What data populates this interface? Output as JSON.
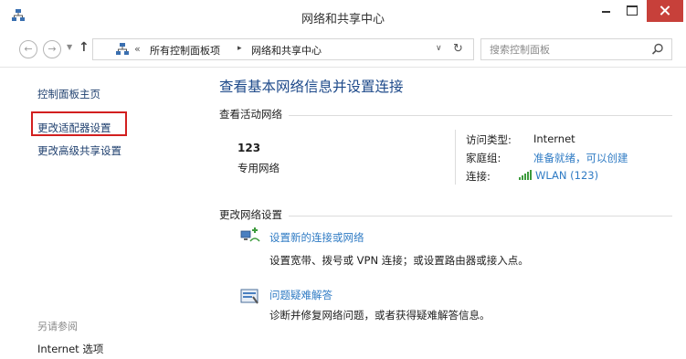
{
  "window": {
    "title": "网络和共享中心"
  },
  "address": {
    "chevron": "«",
    "breadcrumbs": [
      "所有控制面板项",
      "网络和共享中心"
    ],
    "separator": "▸"
  },
  "search": {
    "placeholder": "搜索控制面板"
  },
  "icons": {
    "app": "network-center-icon",
    "back": "back-arrow-icon",
    "forward": "forward-arrow-icon",
    "up": "up-arrow-icon",
    "refresh": "refresh-icon",
    "search": "magnifier-icon",
    "wifi": "wifi-signal-icon",
    "new_connection": "network-setup-icon",
    "troubleshoot": "troubleshoot-icon"
  },
  "sidebar": {
    "home": "控制面板主页",
    "adapter_settings": "更改适配器设置",
    "advanced_sharing": "更改高级共享设置",
    "see_also": "另请参阅",
    "internet_options": "Internet 选项"
  },
  "main": {
    "title": "查看基本网络信息并设置连接",
    "active_networks_heading": "查看活动网络",
    "network": {
      "name": "123",
      "type": "专用网络",
      "access_type_label": "访问类型:",
      "access_type_value": "Internet",
      "homegroup_label": "家庭组:",
      "homegroup_value": "准备就绪，可以创建",
      "connection_label": "连接:",
      "connection_value": "WLAN (123)"
    },
    "change_settings_heading": "更改网络设置",
    "tasks": [
      {
        "link": "设置新的连接或网络",
        "description": "设置宽带、拨号或 VPN 连接；或设置路由器或接入点。"
      },
      {
        "link": "问题疑难解答",
        "description": "诊断并修复网络问题，或者获得疑难解答信息。"
      }
    ]
  },
  "colors": {
    "link": "#2f7bc4",
    "title_blue": "#1e4a8a",
    "close_red": "#c7403a",
    "highlight_red": "#d21f1f"
  }
}
